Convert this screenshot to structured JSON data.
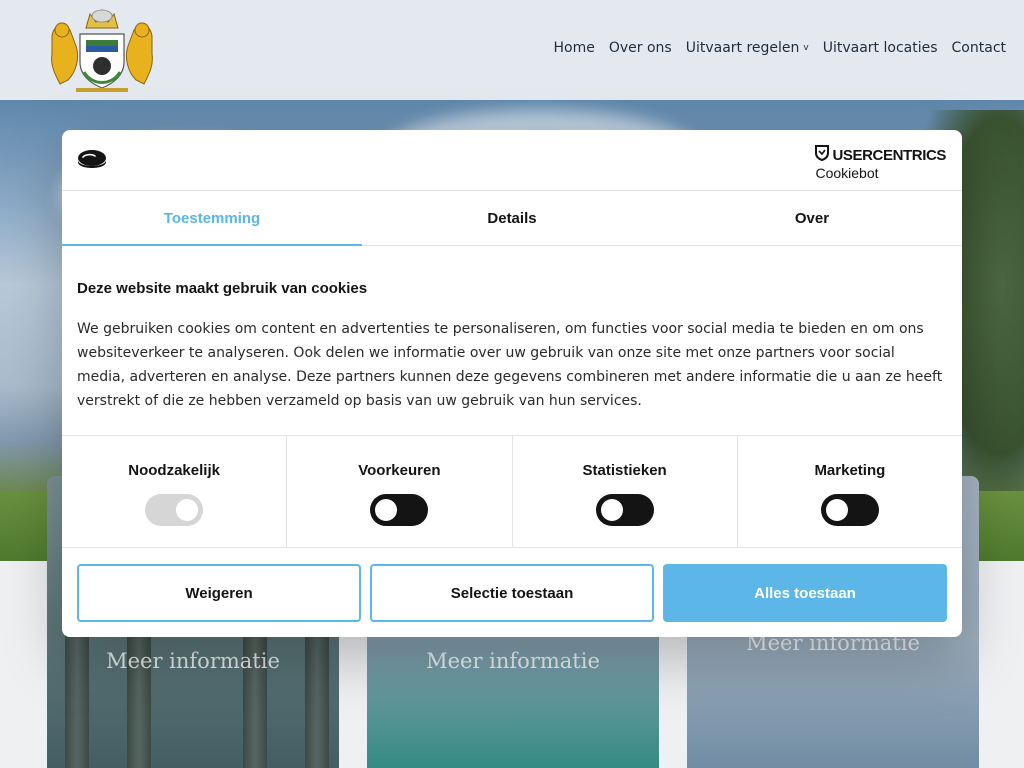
{
  "header": {
    "nav": [
      {
        "label": "Home"
      },
      {
        "label": "Over ons"
      },
      {
        "label": "Uitvaart regelen",
        "has_dropdown": true
      },
      {
        "label": "Uitvaart locaties"
      },
      {
        "label": "Contact"
      }
    ],
    "chevron": "v"
  },
  "cards": [
    {
      "label": "Meer informatie"
    },
    {
      "label": "Meer informatie"
    },
    {
      "label": "Meer informatie"
    }
  ],
  "dialog": {
    "brand_name": "USERCENTRICS",
    "brand_sub": "Cookiebot",
    "tabs": [
      {
        "label": "Toestemming",
        "active": true
      },
      {
        "label": "Details",
        "active": false
      },
      {
        "label": "Over",
        "active": false
      }
    ],
    "heading": "Deze website maakt gebruik van cookies",
    "body": "We gebruiken cookies om content en advertenties te personaliseren, om functies voor social media te bieden en om ons websiteverkeer te analyseren. Ook delen we informatie over uw gebruik van onze site met onze partners voor social media, adverteren en analyse. Deze partners kunnen deze gegevens combineren met andere informatie die u aan ze heeft verstrekt of die ze hebben verzameld op basis van uw gebruik van hun services.",
    "toggles": [
      {
        "label": "Noodzakelijk",
        "state": "on",
        "disabled": true
      },
      {
        "label": "Voorkeuren",
        "state": "off",
        "disabled": false
      },
      {
        "label": "Statistieken",
        "state": "off",
        "disabled": false
      },
      {
        "label": "Marketing",
        "state": "off",
        "disabled": false
      }
    ],
    "buttons": {
      "decline": "Weigeren",
      "selection": "Selectie toestaan",
      "allow_all": "Alles toestaan"
    }
  },
  "colors": {
    "accent": "#5cb6e7",
    "toggle_off": "#141414",
    "toggle_disabled": "#d6d6d6",
    "header_bg": "#e3e9ee"
  },
  "icons": {
    "logo": "coat-of-arms-logo",
    "cookie_logo": "cookie-icon",
    "brand_shield": "shield-icon"
  }
}
